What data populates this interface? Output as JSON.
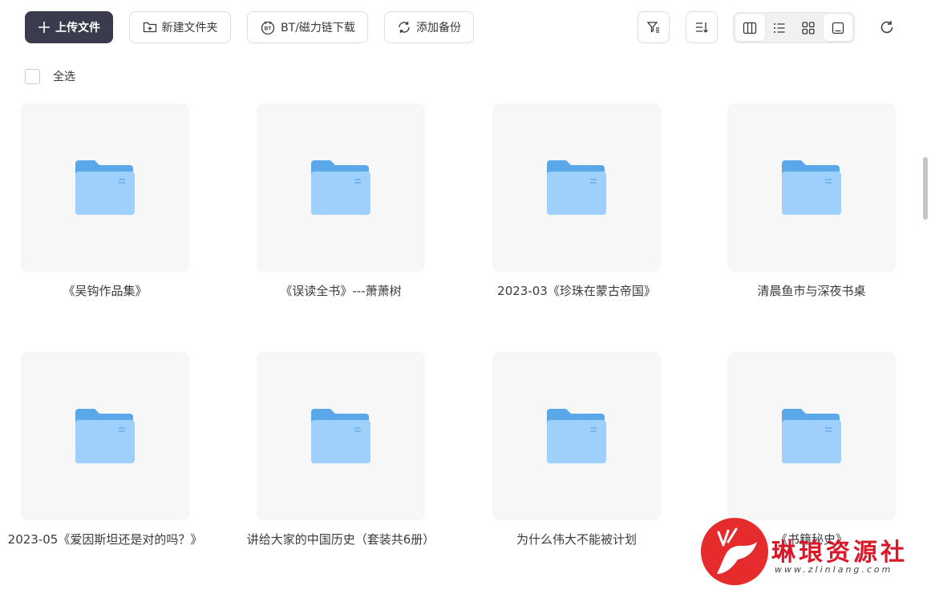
{
  "toolbar": {
    "upload_label": "上传文件",
    "new_folder_label": "新建文件夹",
    "bt_download_label": "BT/磁力链下载",
    "add_backup_label": "添加备份"
  },
  "select_all_label": "全选",
  "items": [
    {
      "name": "《吴钩作品集》"
    },
    {
      "name": "《误读全书》---萧萧树"
    },
    {
      "name": "2023-03《珍珠在蒙古帝国》"
    },
    {
      "name": "清晨鱼市与深夜书桌"
    },
    {
      "name": "2023-05《爱因斯坦还是对的吗？》"
    },
    {
      "name": "讲给大家的中国历史（套装共6册）"
    },
    {
      "name": "为什么伟大不能被计划"
    },
    {
      "name": "《书籍秘史》"
    }
  ],
  "watermark": {
    "title": "琳琅资源社",
    "url": "www.zlinlang.com"
  },
  "colors": {
    "primary_button": "#3a3b4d",
    "folder_back": "#5aa8ea",
    "folder_front": "#9fd0fb",
    "watermark_red": "#e52b2b"
  }
}
